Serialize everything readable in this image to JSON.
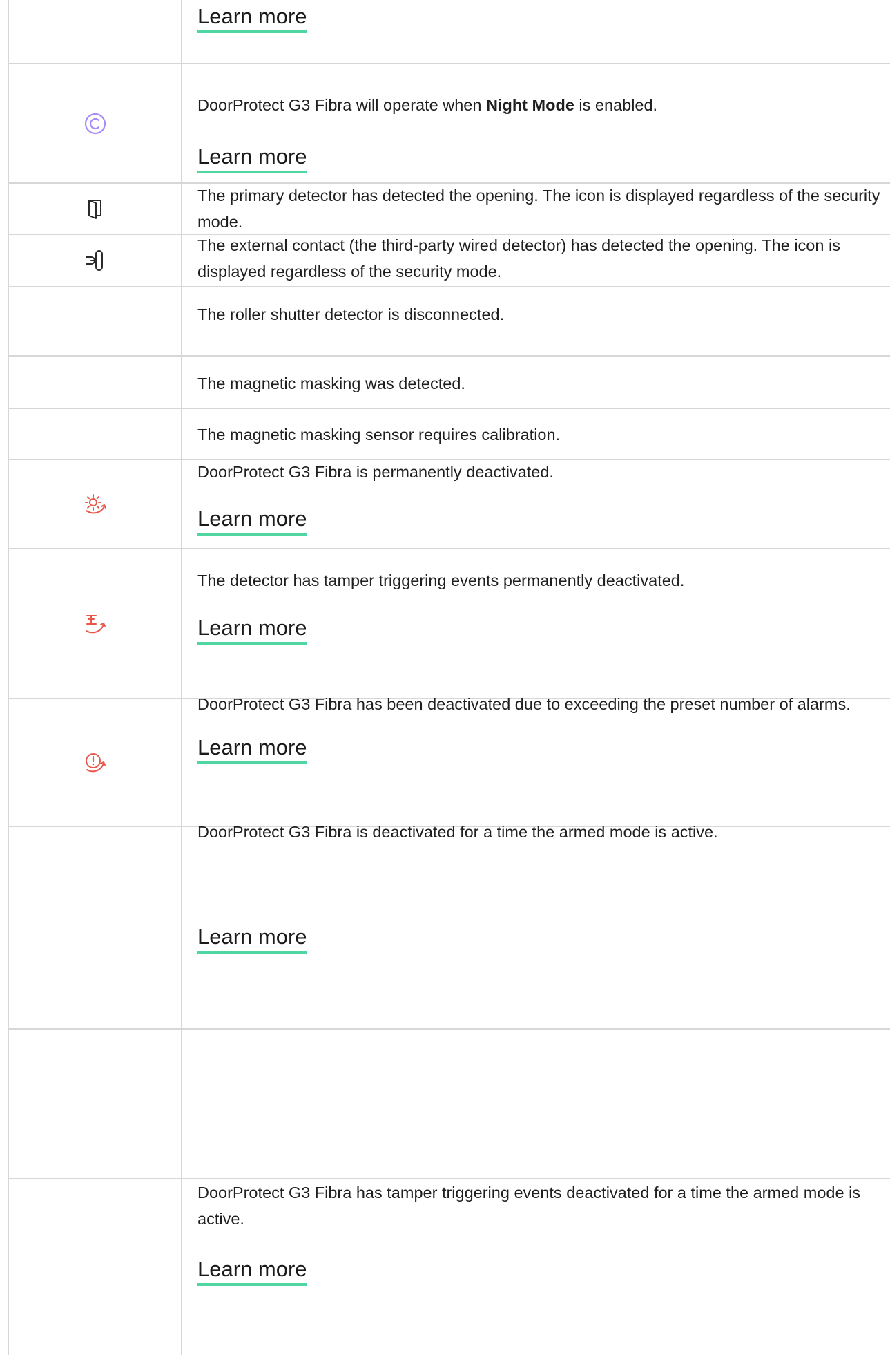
{
  "rows": [
    {
      "id": "r0",
      "icon": "",
      "desc_before": "",
      "desc_bold": "",
      "desc_after": "",
      "link": "Learn more"
    },
    {
      "id": "r1",
      "icon": "night-mode-icon",
      "desc_before": "DoorProtect G3 Fibra will operate when ",
      "desc_bold": "Night Mode",
      "desc_after": " is enabled.",
      "link": "Learn more"
    },
    {
      "id": "r2",
      "icon": "door-open-icon",
      "desc": "The primary detector has detected the opening. The icon is displayed regardless of the security mode."
    },
    {
      "id": "r3",
      "icon": "external-contact-icon",
      "desc": "The external contact (the third-party wired detector) has detected the opening. The icon is displayed regardless of the security mode."
    },
    {
      "id": "r4",
      "icon": "",
      "desc": "The roller shutter detector is disconnected."
    },
    {
      "id": "r5",
      "icon": "",
      "desc": "The magnetic masking was detected."
    },
    {
      "id": "r6",
      "icon": "",
      "desc": "The magnetic masking sensor requires calibration."
    },
    {
      "id": "r7",
      "icon": "permanently-deactivated-icon",
      "desc": "DoorProtect G3 Fibra is permanently deactivated.",
      "link": "Learn more"
    },
    {
      "id": "r8",
      "icon": "tamper-deactivated-icon",
      "desc": "The detector has tamper triggering events permanently deactivated.",
      "link": "Learn more"
    },
    {
      "id": "r9",
      "icon": "alarms-deactivated-icon",
      "desc": "DoorProtect G3 Fibra has been deactivated due to exceeding the preset number of alarms.",
      "link": "Learn more"
    },
    {
      "id": "r10",
      "icon": "",
      "desc": "DoorProtect G3 Fibra is deactivated for a time the armed mode is active.",
      "link": "Learn more"
    },
    {
      "id": "r11",
      "icon": "",
      "desc": "DoorProtect G3 Fibra has tamper triggering events deactivated for a time the armed mode is active.",
      "link": "Learn more"
    }
  ],
  "colors": {
    "night_icon": "#a78bfa",
    "alert_icon": "#e8584a",
    "accent_underline": "#4fd6a1",
    "grid": "#d7d7d7"
  }
}
